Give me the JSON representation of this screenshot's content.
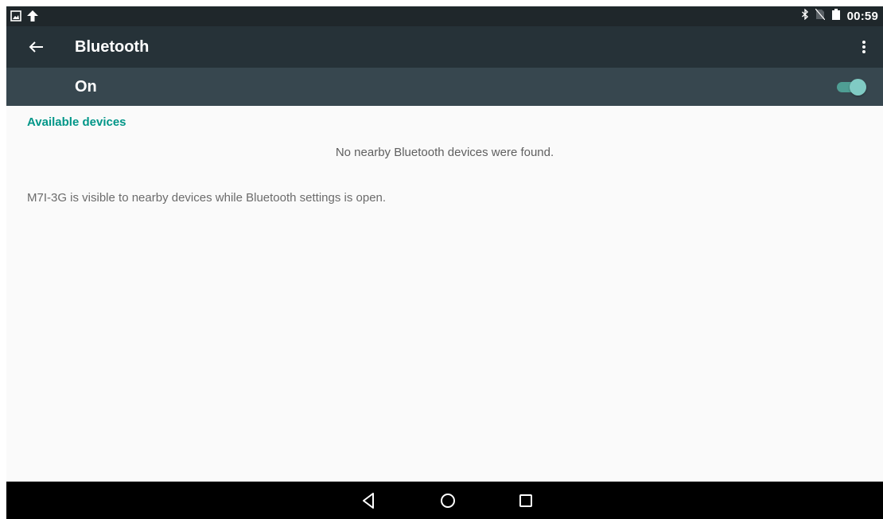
{
  "status_bar": {
    "time": "00:59",
    "left_icons": [
      "picture-icon",
      "upload-arrow-icon"
    ],
    "right_icons": [
      "bluetooth-icon",
      "no-sim-icon",
      "battery-icon"
    ]
  },
  "toolbar": {
    "title": "Bluetooth",
    "back_icon": "back-arrow-icon",
    "overflow_icon": "more-vert-icon"
  },
  "switch_bar": {
    "label": "On",
    "state": true
  },
  "available_devices": {
    "header": "Available devices",
    "empty_message": "No nearby Bluetooth devices were found."
  },
  "footer_text": "M7I-3G is visible to nearby devices while Bluetooth settings is open.",
  "nav_bar": {
    "buttons": [
      "back-nav-icon",
      "home-nav-icon",
      "recents-nav-icon"
    ]
  },
  "colors": {
    "status_bar": "#1f272b",
    "toolbar": "#263238",
    "switch_bar": "#37474f",
    "accent": "#009688",
    "toggle_thumb": "#80cbc4"
  }
}
